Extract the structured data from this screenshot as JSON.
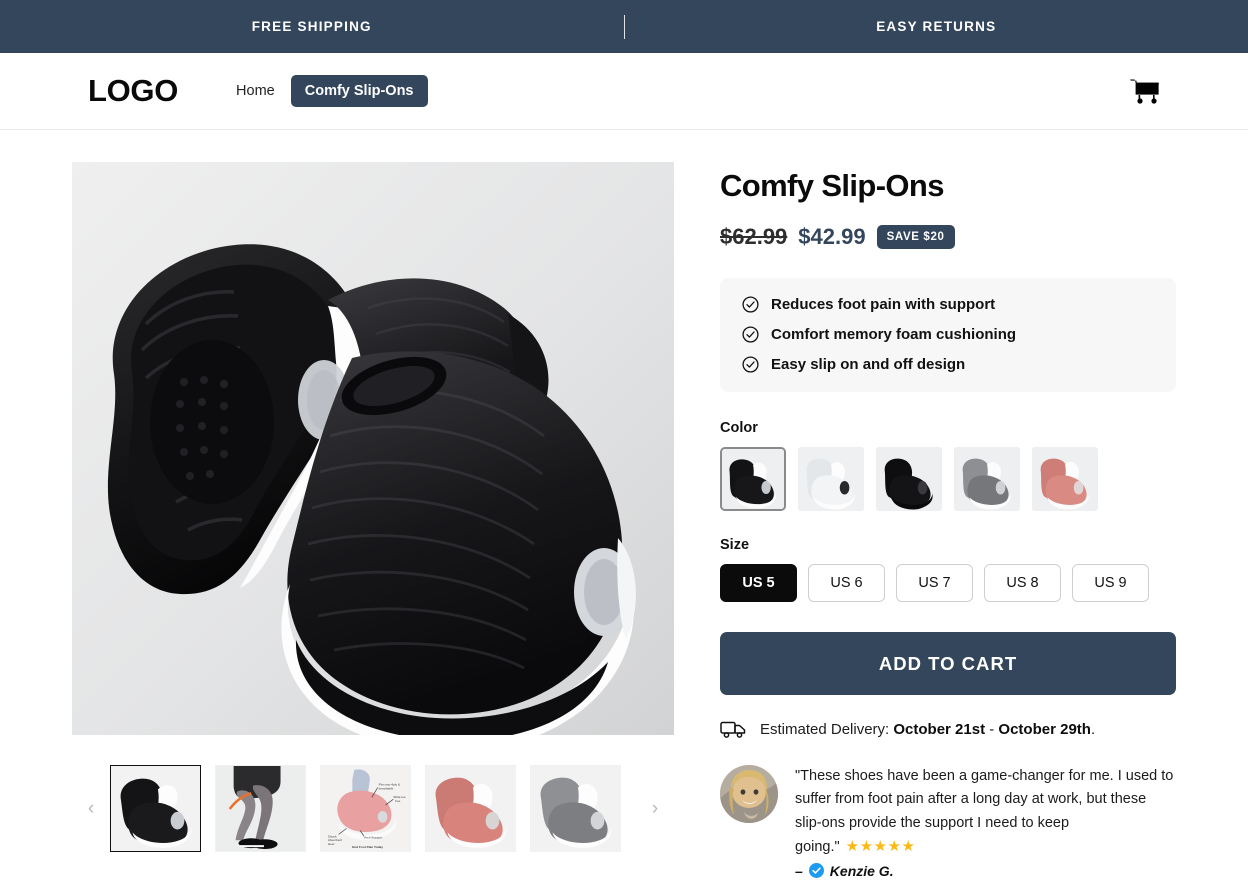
{
  "announcement": {
    "left": "FREE SHIPPING",
    "right": "EASY RETURNS"
  },
  "header": {
    "logo": "LOGO",
    "nav": [
      {
        "label": "Home",
        "active": false
      },
      {
        "label": "Comfy Slip-Ons",
        "active": true
      }
    ],
    "cart_icon": "shopping-cart-icon"
  },
  "gallery": {
    "prev_icon": "chevron-left-icon",
    "next_icon": "chevron-right-icon",
    "thumbnails": [
      {
        "name": "black-sneaker-pair",
        "selected": true
      },
      {
        "name": "model-wearing-black-sneakers"
      },
      {
        "name": "pink-sneaker-infographic"
      },
      {
        "name": "pink-sneaker-pair"
      },
      {
        "name": "gray-sneaker-pair"
      }
    ]
  },
  "product": {
    "title": "Comfy Slip-Ons",
    "price_original": "$62.99",
    "price_sale": "$42.99",
    "save_badge": "SAVE $20",
    "benefits": [
      "Reduces foot pain with support",
      "Comfort memory foam cushioning",
      "Easy slip on and off design"
    ],
    "color_label": "Color",
    "colors": [
      {
        "name": "black",
        "selected": true
      },
      {
        "name": "white",
        "selected": false
      },
      {
        "name": "all-black",
        "selected": false
      },
      {
        "name": "gray",
        "selected": false
      },
      {
        "name": "pink",
        "selected": false
      }
    ],
    "size_label": "Size",
    "sizes": [
      {
        "label": "US 5",
        "selected": true
      },
      {
        "label": "US 6",
        "selected": false
      },
      {
        "label": "US 7",
        "selected": false
      },
      {
        "label": "US 8",
        "selected": false
      },
      {
        "label": "US 9",
        "selected": false
      }
    ],
    "add_to_cart": "ADD TO CART"
  },
  "delivery": {
    "icon": "delivery-truck-icon",
    "prefix": "Estimated Delivery: ",
    "date_start": "October 21st",
    "separator": " - ",
    "date_end": "October 29th",
    "suffix": "."
  },
  "review": {
    "avatar": "customer-avatar",
    "text": "\"These shoes have been a game-changer for me. I used to suffer from foot pain after a long day at work, but these slip-ons provide the support I need to keep going.\"",
    "stars": "★★★★★",
    "author_prefix": "–",
    "verified_icon": "verified-check-icon",
    "author": "Kenzie G."
  },
  "colors_hex": {
    "navy": "#33465c",
    "gold_star": "#fcb912",
    "verified_blue": "#1d9bf0",
    "benefit_bg": "#f7f7f8"
  }
}
